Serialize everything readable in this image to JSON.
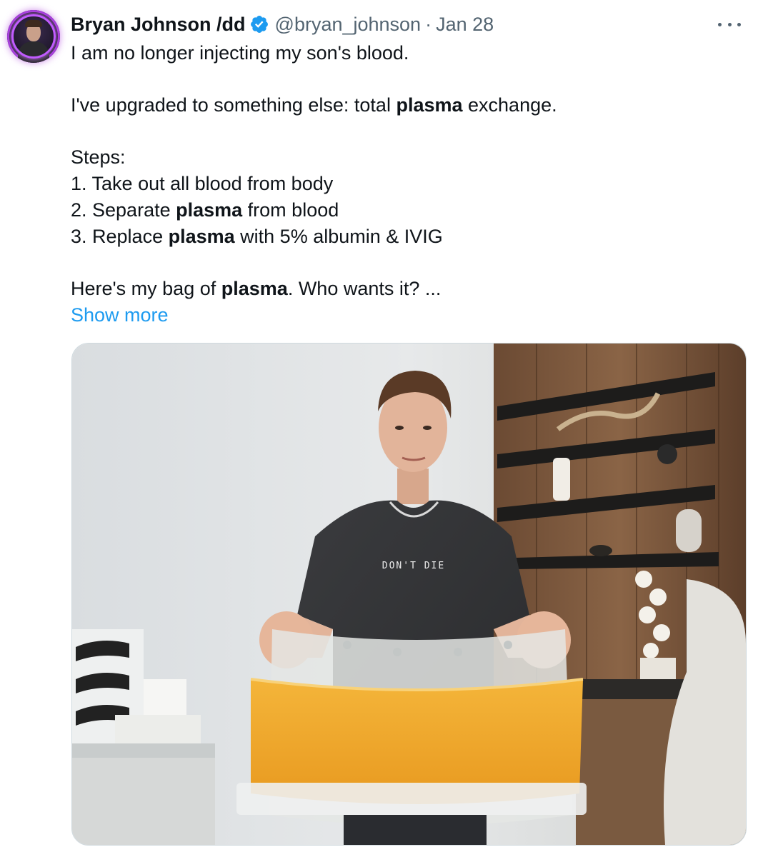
{
  "author": {
    "display_name": "Bryan Johnson /dd",
    "handle": "@bryan_johnson",
    "separator": "·",
    "date": "Jan 28",
    "avatar_icon": "profile-avatar",
    "verified_icon": "verified-badge-icon",
    "verified_color": "#1d9bf0"
  },
  "tweet": {
    "line1": "I am no longer injecting my son's blood.",
    "line2_pre": "I've upgraded to something else: total ",
    "line2_bold": "plasma",
    "line2_post": " exchange.",
    "steps_header": "Steps:",
    "step1": "1. Take out all blood from body",
    "step2_pre": "2. Separate ",
    "step2_bold": "plasma",
    "step2_post": " from blood",
    "step3_pre": "3. Replace ",
    "step3_bold": "plasma",
    "step3_post": " with 5% albumin & IVIG",
    "line_last_pre": "Here's my bag of ",
    "line_last_bold": "plasma",
    "line_last_post": ". Who wants it? ...",
    "show_more": "Show more"
  },
  "media": {
    "shirt_text": "DON'T DIE",
    "description_icon": "photo-man-holding-plasma-bag"
  },
  "colors": {
    "link": "#1d9bf0",
    "secondary_text": "#536471",
    "primary_text": "#0f1419",
    "plasma": "#f0aa2a"
  }
}
